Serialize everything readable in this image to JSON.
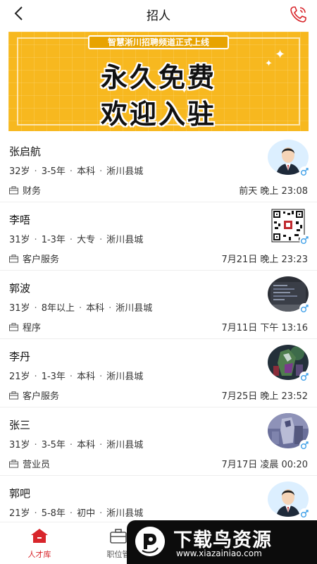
{
  "header": {
    "title": "招人"
  },
  "banner": {
    "tag": "智慧淅川招聘频道正式上线",
    "line1": "永久免费",
    "line2": "欢迎入驻",
    "bg_color": "#f7b81f"
  },
  "candidates": [
    {
      "name": "张启航",
      "age": "32岁",
      "exp": "3-5年",
      "edu": "本科",
      "loc": "淅川县城",
      "category": "财务",
      "time": "前天 晚上 23:08",
      "avatar": "businessman-avatar"
    },
    {
      "name": "李唔",
      "age": "31岁",
      "exp": "1-3年",
      "edu": "大专",
      "loc": "淅川县城",
      "category": "客户服务",
      "time": "7月21日 晚上 23:23",
      "avatar": "qr-code-avatar"
    },
    {
      "name": "郭波",
      "age": "31岁",
      "exp": "8年以上",
      "edu": "本科",
      "loc": "淅川县城",
      "category": "程序",
      "time": "7月11日 下午 13:16",
      "avatar": "screen-photo-avatar"
    },
    {
      "name": "李丹",
      "age": "21岁",
      "exp": "1-3年",
      "edu": "本科",
      "loc": "淅川县城",
      "category": "客户服务",
      "time": "7月25日 晚上 23:52",
      "avatar": "robot-figure-avatar"
    },
    {
      "name": "张三",
      "age": "31岁",
      "exp": "3-5年",
      "edu": "本科",
      "loc": "淅川县城",
      "category": "营业员",
      "time": "7月17日 凌晨 00:20",
      "avatar": "figure-photo-avatar"
    },
    {
      "name": "郭吧",
      "age": "21岁",
      "exp": "5-8年",
      "edu": "初中",
      "loc": "淅川县城",
      "category": "",
      "time": "",
      "avatar": "businessman-avatar"
    }
  ],
  "tabbar": {
    "tab1": "人才库",
    "tab2": "职位管"
  },
  "watermark": {
    "brand": "下载鸟资源",
    "site": "www.xiazainiao.com"
  },
  "colors": {
    "accent": "#d8252b",
    "gender_blue": "#3fa0e8"
  }
}
